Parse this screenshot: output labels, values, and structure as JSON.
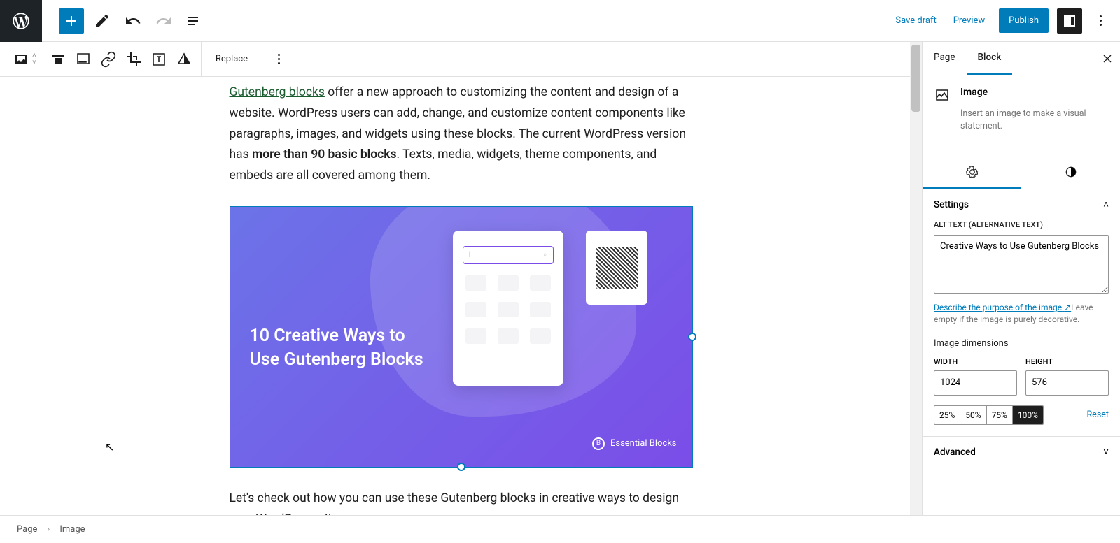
{
  "topbar": {
    "save_draft": "Save draft",
    "preview": "Preview",
    "publish": "Publish"
  },
  "blockbar": {
    "replace": "Replace"
  },
  "content": {
    "link_text": "Gutenberg blocks",
    "para1_a": " offer a new approach to customizing the content and design of a website. WordPress users can add, change, and customize content components like paragraphs, images, and widgets using these blocks. The current WordPress version has ",
    "para1_bold": "more than 90 basic blocks",
    "para1_b": ". Texts, media, widgets, theme components, and embeds are all covered among them.",
    "image_title_l1": "10 Creative Ways to",
    "image_title_l2": "Use Gutenberg Blocks",
    "image_footer": "Essential Blocks",
    "para2": "Let's check out how you can use these Gutenberg blocks in creative ways to design your WordPress site."
  },
  "panel": {
    "tab_page": "Page",
    "tab_block": "Block",
    "block_name": "Image",
    "block_desc": "Insert an image to make a visual statement.",
    "settings_hdr": "Settings",
    "alt_label": "ALT TEXT (ALTERNATIVE TEXT)",
    "alt_value": "Creative Ways to Use Gutenberg Blocks",
    "help_link": "Describe the purpose of the image",
    "help_rest": "Leave empty if the image is purely decorative.",
    "dim_hdr": "Image dimensions",
    "width_lbl": "WIDTH",
    "height_lbl": "HEIGHT",
    "width_val": "1024",
    "height_val": "576",
    "size_25": "25%",
    "size_50": "50%",
    "size_75": "75%",
    "size_100": "100%",
    "reset": "Reset",
    "advanced_hdr": "Advanced"
  },
  "footer": {
    "crumb1": "Page",
    "crumb2": "Image"
  }
}
